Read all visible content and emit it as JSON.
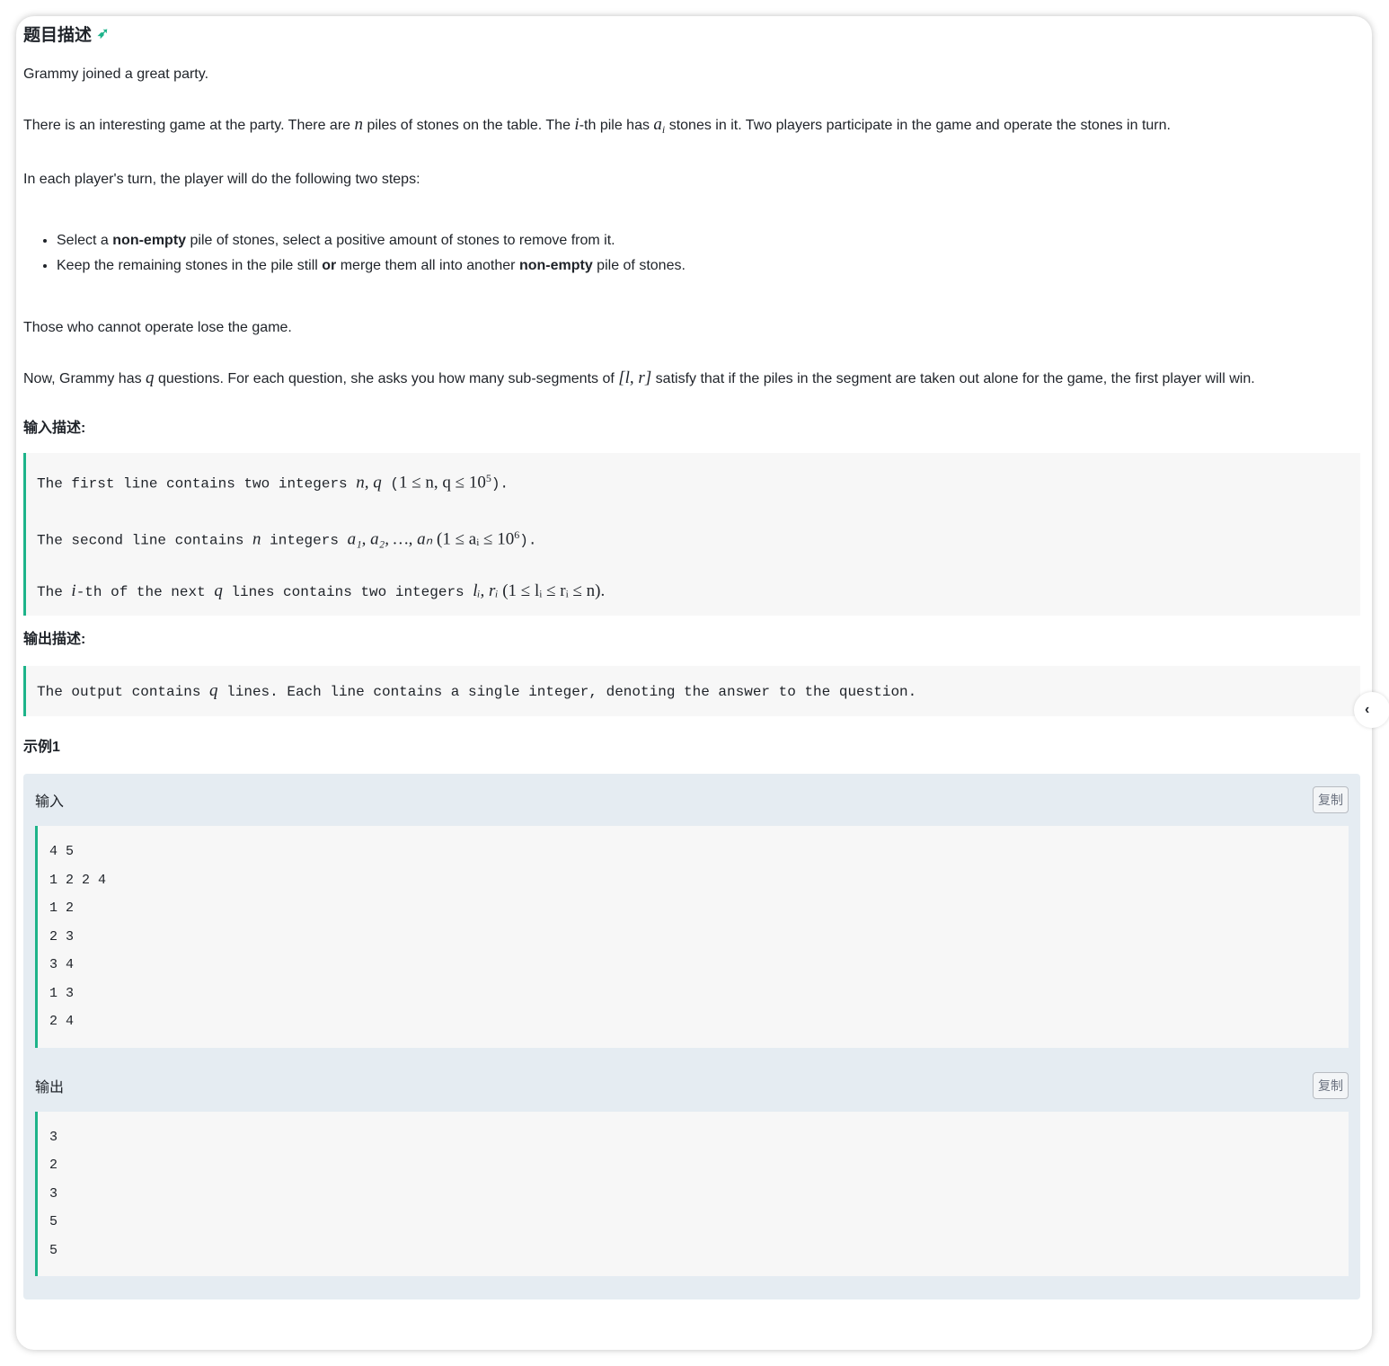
{
  "title": "题目描述",
  "intro": "Grammy joined a great party.",
  "p2": [
    "There is an interesting game at the party. There are ",
    "n",
    " piles of stones on the table. The ",
    "i",
    "-th pile has ",
    "a",
    "i",
    " stones in it. Two players participate in the game and operate the stones in turn."
  ],
  "p3": "In each player's turn, the player will do the following two steps:",
  "steps": [
    [
      "Select a ",
      "non-empty",
      " pile of stones, select a positive amount of stones to remove from it.",
      "",
      ""
    ],
    [
      "Keep the remaining stones in the pile still ",
      "or",
      " merge them all into another ",
      "non-empty",
      " pile of stones."
    ]
  ],
  "p4": "Those who cannot operate lose the game.",
  "p5": [
    "Now, Grammy has ",
    "q",
    " questions. For each question, she asks you how many sub-segments of ",
    "[l, r]",
    " satisfy that if the piles in the segment are taken out alone for the game, the first player will win."
  ],
  "input_heading": "输入描述:",
  "input_lines": [
    [
      "The first line contains two integers ",
      "n, q",
      " (",
      "1 ≤ n, q ≤ 10",
      "5",
      ")."
    ],
    [
      "The second line contains ",
      "n",
      " integers ",
      "a₁, a₂, …, aₙ",
      " (1 ≤ aᵢ ≤ 10",
      "6",
      ")."
    ],
    [
      "The ",
      "i",
      "-th of the next ",
      "q",
      " lines contains two integers ",
      "lᵢ, rᵢ",
      " (1 ≤ lᵢ ≤ rᵢ ≤ n)."
    ]
  ],
  "output_heading": "输出描述:",
  "output_desc": [
    "The output contains ",
    "q",
    " lines. Each line contains a single integer, denoting the answer to the question."
  ],
  "example_heading": "示例1",
  "sample_input": {
    "label": "输入",
    "copy": "复制",
    "lines": [
      "4 5",
      "1 2 2 4",
      "1 2",
      "2 3",
      "3 4",
      "1 3",
      "2 4"
    ]
  },
  "sample_output": {
    "label": "输出",
    "copy": "复制",
    "lines": [
      "3",
      "2",
      "3",
      "5",
      "5"
    ]
  },
  "accent": "#1db38a"
}
